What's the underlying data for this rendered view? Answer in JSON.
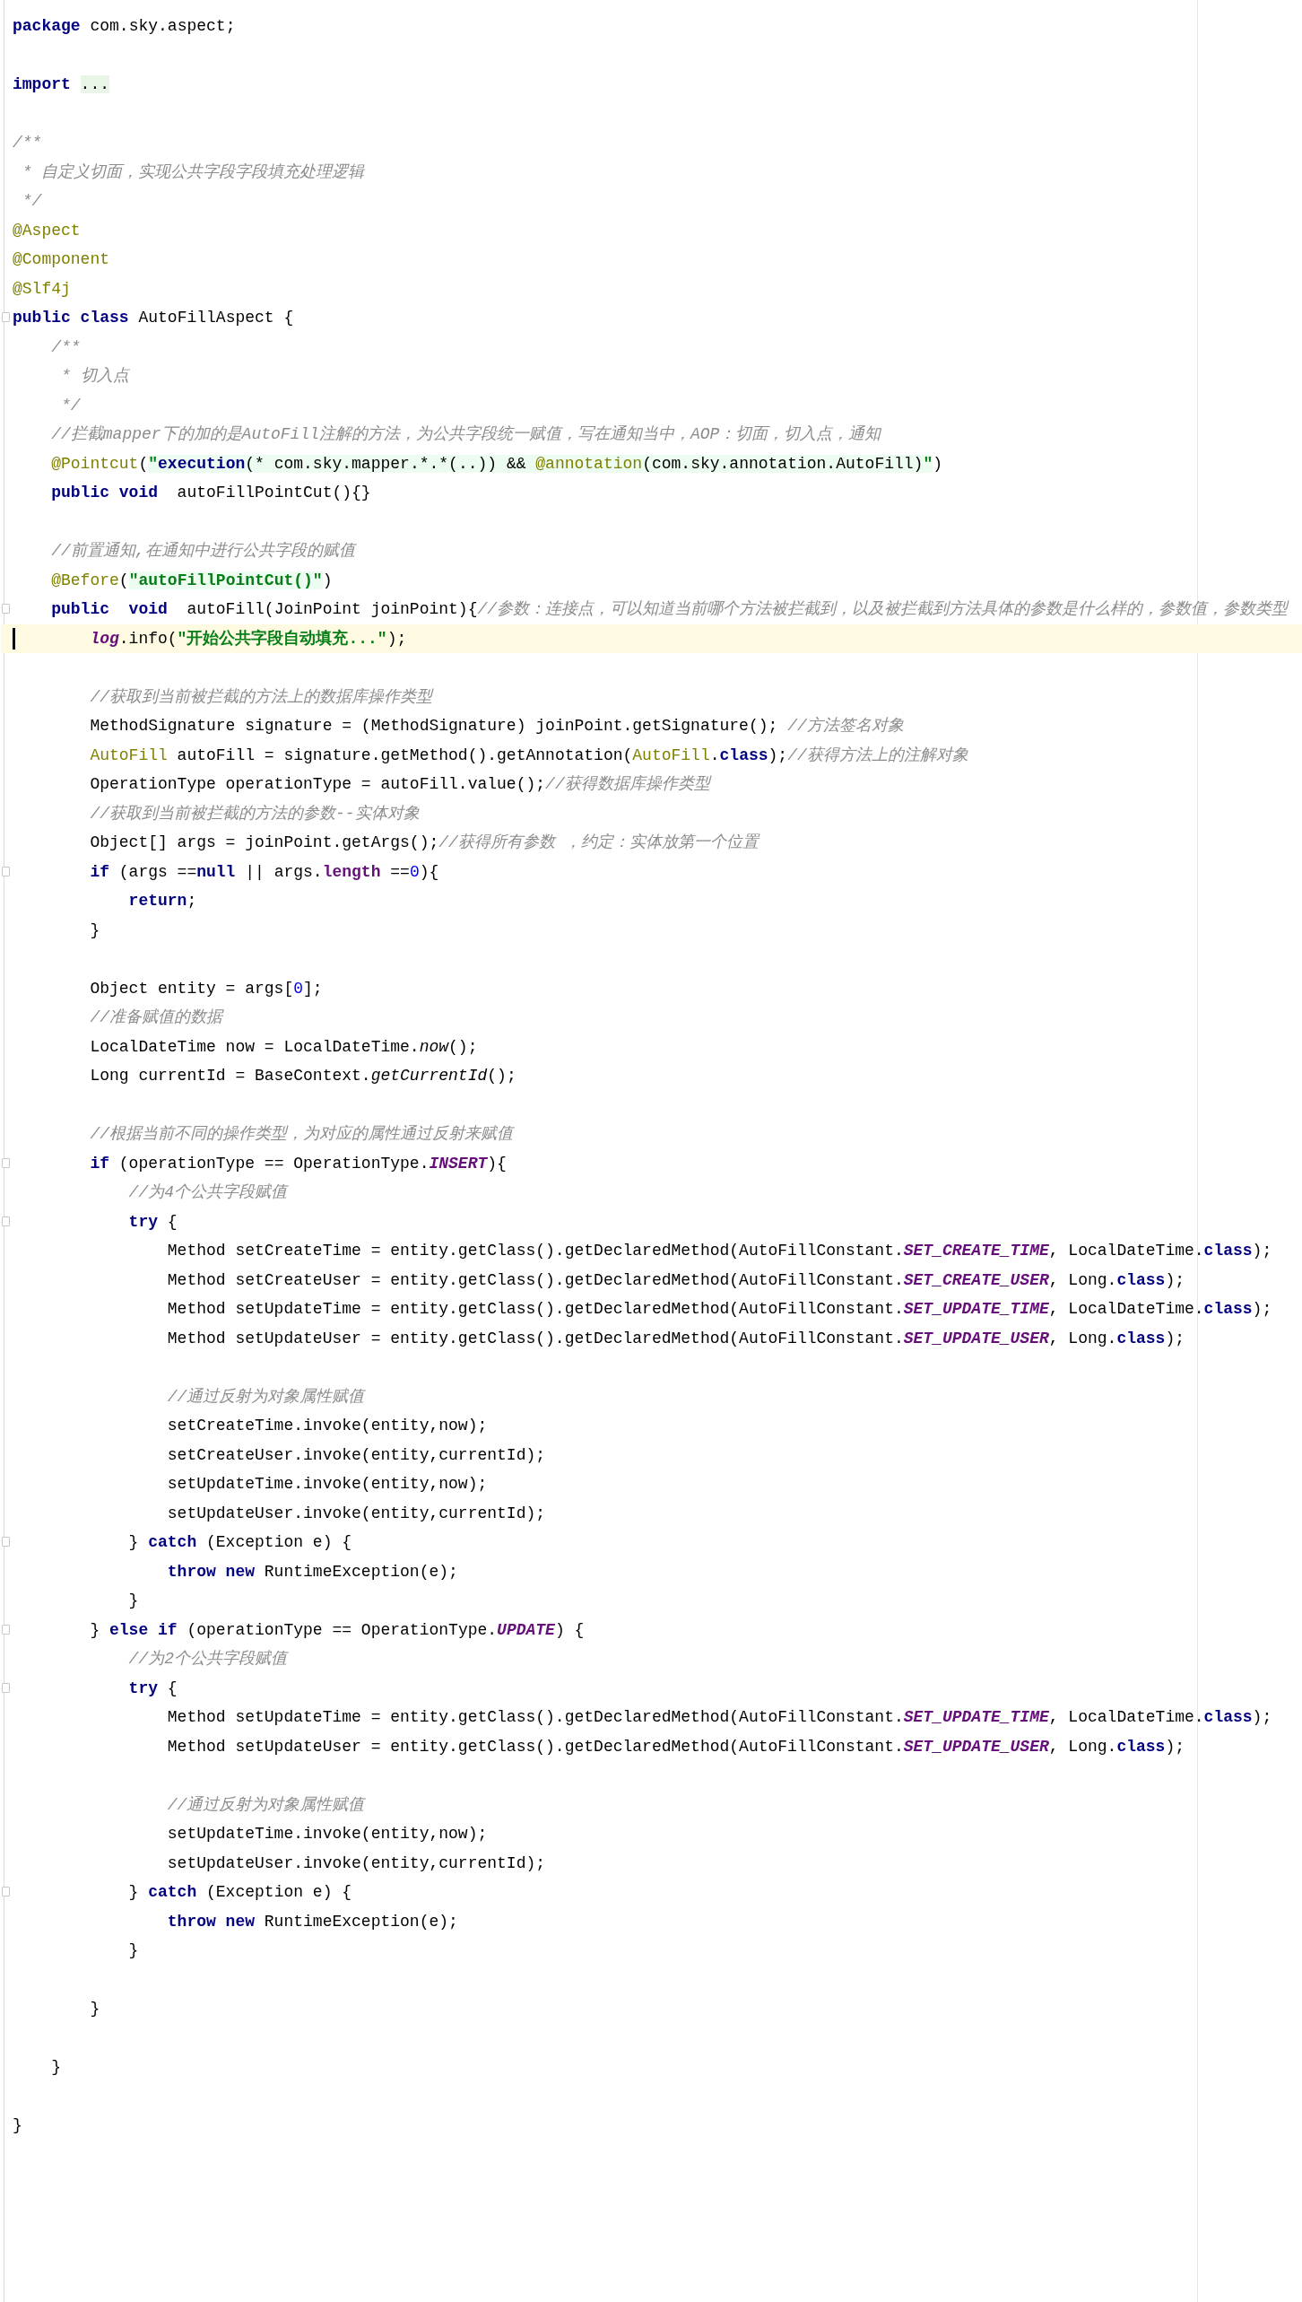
{
  "editor": {
    "lines": [
      {
        "kind": "code",
        "current": false,
        "tokens": [
          {
            "kind": "keyword",
            "text": "package"
          },
          {
            "kind": "plain",
            "text": " com.sky.aspect;"
          }
        ]
      },
      {
        "kind": "blank",
        "current": false
      },
      {
        "kind": "code",
        "current": false,
        "tokens": [
          {
            "kind": "keyword",
            "text": "import"
          },
          {
            "kind": "folded",
            "text": "..."
          }
        ]
      },
      {
        "kind": "blank",
        "current": false
      },
      {
        "kind": "code",
        "current": false,
        "tokens": [
          {
            "kind": "comment",
            "text": "/**"
          }
        ]
      },
      {
        "kind": "code",
        "current": false,
        "tokens": [
          {
            "kind": "comment",
            "text": " * 自定义切面，实现公共字段字段填充处理逻辑"
          }
        ]
      },
      {
        "kind": "code",
        "current": false,
        "tokens": [
          {
            "kind": "comment",
            "text": " */"
          }
        ]
      },
      {
        "kind": "code",
        "current": false,
        "tokens": [
          {
            "kind": "annotation",
            "text": "@Aspect"
          }
        ]
      },
      {
        "kind": "code",
        "current": false,
        "tokens": [
          {
            "kind": "annotation",
            "text": "@Component"
          }
        ]
      },
      {
        "kind": "code",
        "current": false,
        "tokens": [
          {
            "kind": "annotation",
            "text": "@Slf4j"
          }
        ]
      },
      {
        "kind": "code",
        "current": false,
        "tokens": [
          {
            "kind": "keyword",
            "text": "public class"
          },
          {
            "kind": "plain",
            "text": " AutoFillAspect {"
          }
        ],
        "children": [
          {
            "kind": "code",
            "current": false,
            "tokens": [
              {
                "kind": "comment",
                "text": "/**"
              }
            ]
          },
          {
            "kind": "code",
            "current": false,
            "tokens": [
              {
                "kind": "comment",
                "text": " * 切入点"
              }
            ]
          },
          {
            "kind": "code",
            "current": false,
            "tokens": [
              {
                "kind": "comment",
                "text": " */"
              }
            ]
          },
          {
            "kind": "code",
            "current": false,
            "tokens": [
              {
                "kind": "comment",
                "text": "//拦截mapper下的加的是AutoFill注解的方法，为公共字段统一赋值，写在通知当中，AOP：切面，切入点，通知"
              }
            ]
          },
          {
            "kind": "code",
            "current": false,
            "tokens": [
              {
                "kind": "annotation",
                "text": "@Pointcut"
              },
              {
                "kind": "plain",
                "text": "("
              },
              {
                "kind": "inj_string",
                "text": "\""
              },
              {
                "kind": "inj_keyword",
                "text": "execution"
              },
              {
                "kind": "inj_plain",
                "text": "(* com.sky.mapper.*.*(..)) && "
              },
              {
                "kind": "inj_annotation",
                "text": "@annotation"
              },
              {
                "kind": "inj_plain",
                "text": "(com.sky.annotation.AutoFill)"
              },
              {
                "kind": "inj_string",
                "text": "\""
              },
              {
                "kind": "plain",
                "text": ")"
              }
            ]
          },
          {
            "kind": "code",
            "current": false,
            "tokens": [
              {
                "kind": "keyword",
                "text": "public void"
              },
              {
                "kind": "plain",
                "text": "  autoFillPointCut(){}"
              }
            ]
          },
          {
            "kind": "blank",
            "current": false
          },
          {
            "kind": "code",
            "current": false,
            "tokens": [
              {
                "kind": "comment",
                "text": "//前置通知,在通知中进行公共字段的赋值"
              }
            ]
          },
          {
            "kind": "code",
            "current": false,
            "tokens": [
              {
                "kind": "annotation",
                "text": "@Before"
              },
              {
                "kind": "plain",
                "text": "("
              },
              {
                "kind": "inj_string",
                "text": "\"autoFillPointCut()\""
              },
              {
                "kind": "plain",
                "text": ")"
              }
            ]
          },
          {
            "kind": "code",
            "current": false,
            "tokens": [
              {
                "kind": "keyword",
                "text": "public  void"
              },
              {
                "kind": "plain",
                "text": "  autoFill(JoinPoint joinPoint){"
              },
              {
                "kind": "comment",
                "text": "//参数：连接点，可以知道当前哪个方法被拦截到，以及被拦截到方法具体的参数是什么样的，参数值，参数类型"
              }
            ],
            "children": [
              {
                "kind": "code",
                "current": true,
                "tokens": [
                  {
                    "kind": "static_field",
                    "text": "log"
                  },
                  {
                    "kind": "plain",
                    "text": ".info("
                  },
                  {
                    "kind": "string",
                    "text": "\"开始公共字段自动填充...\""
                  },
                  {
                    "kind": "plain",
                    "text": ");"
                  }
                ]
              },
              {
                "kind": "blank",
                "current": false
              },
              {
                "kind": "code",
                "current": false,
                "tokens": [
                  {
                    "kind": "comment",
                    "text": "//获取到当前被拦截的方法上的数据库操作类型"
                  }
                ]
              },
              {
                "kind": "code",
                "current": false,
                "tokens": [
                  {
                    "kind": "plain",
                    "text": "MethodSignature signature = (MethodSignature) joinPoint.getSignature(); "
                  },
                  {
                    "kind": "comment",
                    "text": "//方法签名对象"
                  }
                ]
              },
              {
                "kind": "code",
                "current": false,
                "tokens": [
                  {
                    "kind": "annotation",
                    "text": "AutoFill"
                  },
                  {
                    "kind": "plain",
                    "text": " autoFill = signature.getMethod().getAnnotation("
                  },
                  {
                    "kind": "annotation",
                    "text": "AutoFill"
                  },
                  {
                    "kind": "plain",
                    "text": "."
                  },
                  {
                    "kind": "keyword",
                    "text": "class"
                  },
                  {
                    "kind": "plain",
                    "text": ");"
                  },
                  {
                    "kind": "comment",
                    "text": "//获得方法上的注解对象"
                  }
                ]
              },
              {
                "kind": "code",
                "current": false,
                "tokens": [
                  {
                    "kind": "plain",
                    "text": "OperationType operationType = autoFill.value();"
                  },
                  {
                    "kind": "comment",
                    "text": "//获得数据库操作类型"
                  }
                ]
              },
              {
                "kind": "code",
                "current": false,
                "tokens": [
                  {
                    "kind": "comment",
                    "text": "//获取到当前被拦截的方法的参数--实体对象"
                  }
                ]
              },
              {
                "kind": "code",
                "current": false,
                "tokens": [
                  {
                    "kind": "plain",
                    "text": "Object[] args = joinPoint.getArgs();"
                  },
                  {
                    "kind": "comment",
                    "text": "//获得所有参数 ，约定：实体放第一个位置"
                  }
                ]
              },
              {
                "kind": "code",
                "current": false,
                "tokens": [
                  {
                    "kind": "keyword",
                    "text": "if"
                  },
                  {
                    "kind": "plain",
                    "text": " (args =="
                  },
                  {
                    "kind": "keyword",
                    "text": "null"
                  },
                  {
                    "kind": "plain",
                    "text": " || args."
                  },
                  {
                    "kind": "field",
                    "text": "length"
                  },
                  {
                    "kind": "plain",
                    "text": " =="
                  },
                  {
                    "kind": "number",
                    "text": "0"
                  },
                  {
                    "kind": "plain",
                    "text": "){"
                  }
                ],
                "children": [
                  {
                    "kind": "code",
                    "current": false,
                    "tokens": [
                      {
                        "kind": "keyword",
                        "text": "return"
                      },
                      {
                        "kind": "plain",
                        "text": ";"
                      }
                    ]
                  }
                ]
              },
              {
                "kind": "code",
                "current": false,
                "tokens": [
                  {
                    "kind": "plain",
                    "text": "}"
                  }
                ]
              },
              {
                "kind": "blank",
                "current": false
              },
              {
                "kind": "code",
                "current": false,
                "tokens": [
                  {
                    "kind": "plain",
                    "text": "Object entity = args["
                  },
                  {
                    "kind": "number",
                    "text": "0"
                  },
                  {
                    "kind": "plain",
                    "text": "];"
                  }
                ]
              },
              {
                "kind": "code",
                "current": false,
                "tokens": [
                  {
                    "kind": "comment",
                    "text": "//准备赋值的数据"
                  }
                ]
              },
              {
                "kind": "code",
                "current": false,
                "tokens": [
                  {
                    "kind": "plain",
                    "text": "LocalDateTime now = LocalDateTime."
                  },
                  {
                    "kind": "static_call",
                    "text": "now"
                  },
                  {
                    "kind": "plain",
                    "text": "();"
                  }
                ]
              },
              {
                "kind": "code",
                "current": false,
                "tokens": [
                  {
                    "kind": "plain",
                    "text": "Long currentId = BaseContext."
                  },
                  {
                    "kind": "static_call",
                    "text": "getCurrentId"
                  },
                  {
                    "kind": "plain",
                    "text": "();"
                  }
                ]
              },
              {
                "kind": "blank",
                "current": false
              },
              {
                "kind": "code",
                "current": false,
                "tokens": [
                  {
                    "kind": "comment",
                    "text": "//根据当前不同的操作类型，为对应的属性通过反射来赋值"
                  }
                ]
              },
              {
                "kind": "code",
                "current": false,
                "tokens": [
                  {
                    "kind": "keyword",
                    "text": "if"
                  },
                  {
                    "kind": "plain",
                    "text": " (operationType == OperationType."
                  },
                  {
                    "kind": "constant",
                    "text": "INSERT"
                  },
                  {
                    "kind": "plain",
                    "text": "){"
                  }
                ],
                "children": [
                  {
                    "kind": "code",
                    "current": false,
                    "tokens": [
                      {
                        "kind": "comment",
                        "text": "//为4个公共字段赋值"
                      }
                    ]
                  },
                  {
                    "kind": "code",
                    "current": false,
                    "tokens": [
                      {
                        "kind": "keyword",
                        "text": "try"
                      },
                      {
                        "kind": "plain",
                        "text": " {"
                      }
                    ],
                    "children": [
                      {
                        "kind": "code",
                        "current": false,
                        "tokens": [
                          {
                            "kind": "plain",
                            "text": "Method setCreateTime = entity.getClass().getDeclaredMethod(AutoFillConstant."
                          },
                          {
                            "kind": "constant",
                            "text": "SET_CREATE_TIME"
                          },
                          {
                            "kind": "plain",
                            "text": ", LocalDateTime."
                          },
                          {
                            "kind": "keyword",
                            "text": "class"
                          },
                          {
                            "kind": "plain",
                            "text": ");"
                          }
                        ]
                      },
                      {
                        "kind": "code",
                        "current": false,
                        "tokens": [
                          {
                            "kind": "plain",
                            "text": "Method setCreateUser = entity.getClass().getDeclaredMethod(AutoFillConstant."
                          },
                          {
                            "kind": "constant",
                            "text": "SET_CREATE_USER"
                          },
                          {
                            "kind": "plain",
                            "text": ", Long."
                          },
                          {
                            "kind": "keyword",
                            "text": "class"
                          },
                          {
                            "kind": "plain",
                            "text": ");"
                          }
                        ]
                      },
                      {
                        "kind": "code",
                        "current": false,
                        "tokens": [
                          {
                            "kind": "plain",
                            "text": "Method setUpdateTime = entity.getClass().getDeclaredMethod(AutoFillConstant."
                          },
                          {
                            "kind": "constant",
                            "text": "SET_UPDATE_TIME"
                          },
                          {
                            "kind": "plain",
                            "text": ", LocalDateTime."
                          },
                          {
                            "kind": "keyword",
                            "text": "class"
                          },
                          {
                            "kind": "plain",
                            "text": ");"
                          }
                        ]
                      },
                      {
                        "kind": "code",
                        "current": false,
                        "tokens": [
                          {
                            "kind": "plain",
                            "text": "Method setUpdateUser = entity.getClass().getDeclaredMethod(AutoFillConstant."
                          },
                          {
                            "kind": "constant",
                            "text": "SET_UPDATE_USER"
                          },
                          {
                            "kind": "plain",
                            "text": ", Long."
                          },
                          {
                            "kind": "keyword",
                            "text": "class"
                          },
                          {
                            "kind": "plain",
                            "text": ");"
                          }
                        ]
                      },
                      {
                        "kind": "blank",
                        "current": false
                      },
                      {
                        "kind": "code",
                        "current": false,
                        "tokens": [
                          {
                            "kind": "comment",
                            "text": "//通过反射为对象属性赋值"
                          }
                        ]
                      },
                      {
                        "kind": "code",
                        "current": false,
                        "tokens": [
                          {
                            "kind": "plain",
                            "text": "setCreateTime.invoke(entity,now);"
                          }
                        ]
                      },
                      {
                        "kind": "code",
                        "current": false,
                        "tokens": [
                          {
                            "kind": "plain",
                            "text": "setCreateUser.invoke(entity,currentId);"
                          }
                        ]
                      },
                      {
                        "kind": "code",
                        "current": false,
                        "tokens": [
                          {
                            "kind": "plain",
                            "text": "setUpdateTime.invoke(entity,now);"
                          }
                        ]
                      },
                      {
                        "kind": "code",
                        "current": false,
                        "tokens": [
                          {
                            "kind": "plain",
                            "text": "setUpdateUser.invoke(entity,currentId);"
                          }
                        ]
                      }
                    ]
                  },
                  {
                    "kind": "code",
                    "current": false,
                    "tokens": [
                      {
                        "kind": "plain",
                        "text": "} "
                      },
                      {
                        "kind": "keyword",
                        "text": "catch"
                      },
                      {
                        "kind": "plain",
                        "text": " (Exception e) {"
                      }
                    ],
                    "children": [
                      {
                        "kind": "code",
                        "current": false,
                        "tokens": [
                          {
                            "kind": "keyword",
                            "text": "throw new"
                          },
                          {
                            "kind": "plain",
                            "text": " RuntimeException(e);"
                          }
                        ]
                      }
                    ]
                  },
                  {
                    "kind": "code",
                    "current": false,
                    "tokens": [
                      {
                        "kind": "plain",
                        "text": "}"
                      }
                    ]
                  }
                ]
              },
              {
                "kind": "code",
                "current": false,
                "tokens": [
                  {
                    "kind": "plain",
                    "text": "} "
                  },
                  {
                    "kind": "keyword",
                    "text": "else if"
                  },
                  {
                    "kind": "plain",
                    "text": " (operationType == OperationType."
                  },
                  {
                    "kind": "constant",
                    "text": "UPDATE"
                  },
                  {
                    "kind": "plain",
                    "text": ") {"
                  }
                ],
                "children": [
                  {
                    "kind": "code",
                    "current": false,
                    "tokens": [
                      {
                        "kind": "comment",
                        "text": "//为2个公共字段赋值"
                      }
                    ]
                  },
                  {
                    "kind": "code",
                    "current": false,
                    "tokens": [
                      {
                        "kind": "keyword",
                        "text": "try"
                      },
                      {
                        "kind": "plain",
                        "text": " {"
                      }
                    ],
                    "children": [
                      {
                        "kind": "code",
                        "current": false,
                        "tokens": [
                          {
                            "kind": "plain",
                            "text": "Method setUpdateTime = entity.getClass().getDeclaredMethod(AutoFillConstant."
                          },
                          {
                            "kind": "constant",
                            "text": "SET_UPDATE_TIME"
                          },
                          {
                            "kind": "plain",
                            "text": ", LocalDateTime."
                          },
                          {
                            "kind": "keyword",
                            "text": "class"
                          },
                          {
                            "kind": "plain",
                            "text": ");"
                          }
                        ]
                      },
                      {
                        "kind": "code",
                        "current": false,
                        "tokens": [
                          {
                            "kind": "plain",
                            "text": "Method setUpdateUser = entity.getClass().getDeclaredMethod(AutoFillConstant."
                          },
                          {
                            "kind": "constant",
                            "text": "SET_UPDATE_USER"
                          },
                          {
                            "kind": "plain",
                            "text": ", Long."
                          },
                          {
                            "kind": "keyword",
                            "text": "class"
                          },
                          {
                            "kind": "plain",
                            "text": ");"
                          }
                        ]
                      },
                      {
                        "kind": "blank",
                        "current": false
                      },
                      {
                        "kind": "code",
                        "current": false,
                        "tokens": [
                          {
                            "kind": "comment",
                            "text": "//通过反射为对象属性赋值"
                          }
                        ]
                      },
                      {
                        "kind": "code",
                        "current": false,
                        "tokens": [
                          {
                            "kind": "plain",
                            "text": "setUpdateTime.invoke(entity,now);"
                          }
                        ]
                      },
                      {
                        "kind": "code",
                        "current": false,
                        "tokens": [
                          {
                            "kind": "plain",
                            "text": "setUpdateUser.invoke(entity,currentId);"
                          }
                        ]
                      }
                    ]
                  },
                  {
                    "kind": "code",
                    "current": false,
                    "tokens": [
                      {
                        "kind": "plain",
                        "text": "} "
                      },
                      {
                        "kind": "keyword",
                        "text": "catch"
                      },
                      {
                        "kind": "plain",
                        "text": " (Exception e) {"
                      }
                    ],
                    "children": [
                      {
                        "kind": "code",
                        "current": false,
                        "tokens": [
                          {
                            "kind": "keyword",
                            "text": "throw new"
                          },
                          {
                            "kind": "plain",
                            "text": " RuntimeException(e);"
                          }
                        ]
                      }
                    ]
                  },
                  {
                    "kind": "code",
                    "current": false,
                    "tokens": [
                      {
                        "kind": "plain",
                        "text": "}"
                      }
                    ]
                  },
                  {
                    "kind": "blank",
                    "current": false
                  }
                ]
              },
              {
                "kind": "code",
                "current": false,
                "tokens": [
                  {
                    "kind": "plain",
                    "text": "}"
                  }
                ]
              },
              {
                "kind": "blank",
                "current": false
              }
            ]
          },
          {
            "kind": "code",
            "current": false,
            "tokens": [
              {
                "kind": "plain",
                "text": "}"
              }
            ]
          },
          {
            "kind": "blank",
            "current": false
          }
        ]
      },
      {
        "kind": "code",
        "current": false,
        "tokens": [
          {
            "kind": "plain",
            "text": "}"
          }
        ]
      }
    ]
  }
}
